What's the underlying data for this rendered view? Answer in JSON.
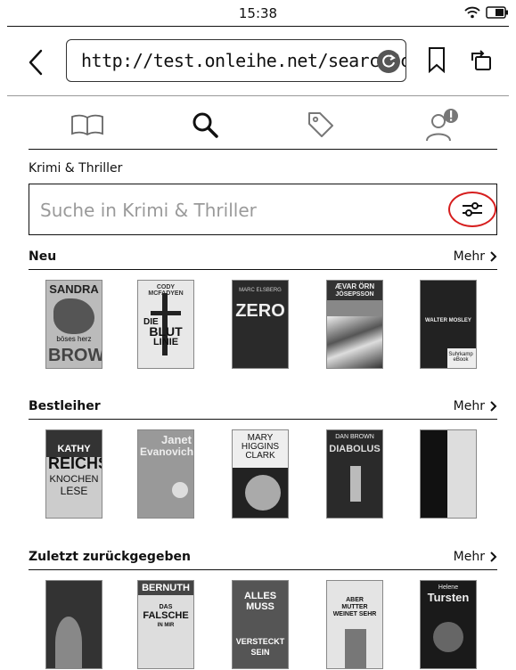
{
  "status": {
    "time": "15:38"
  },
  "browser": {
    "url": "http://test.onleihe.net/search?ci"
  },
  "breadcrumb": "Krimi & Thriller",
  "search": {
    "placeholder": "Suche in Krimi & Thriller"
  },
  "sections": [
    {
      "title": "Neu",
      "more": "Mehr",
      "books": [
        {
          "lines": [
            "SANDRA",
            "böses herz",
            "BROWN"
          ]
        },
        {
          "lines": [
            "CODY MCFADYEN",
            "DIE",
            "BLUT",
            "LINIE"
          ]
        },
        {
          "lines": [
            "MARC ELSBERG",
            "ZERO"
          ]
        },
        {
          "lines": [
            "ÆVAR ÖRN",
            "JÓSEPSSON"
          ]
        },
        {
          "lines": [
            "WALTER MOSLEY",
            "Suhrkamp eBook"
          ]
        }
      ]
    },
    {
      "title": "Bestleiher",
      "more": "Mehr",
      "books": [
        {
          "lines": [
            "KATHY",
            "REICHS",
            "KNOCHEN",
            "LESE"
          ]
        },
        {
          "lines": [
            "Janet",
            "Evanovich"
          ]
        },
        {
          "lines": [
            "MARY",
            "HIGGINS",
            "CLARK"
          ]
        },
        {
          "lines": [
            "DAN BROWN",
            "DIABOLUS"
          ]
        },
        {
          "lines": []
        }
      ]
    },
    {
      "title": "Zuletzt zurückgegeben",
      "more": "Mehr",
      "books": [
        {
          "lines": []
        },
        {
          "lines": [
            "BERNUTH",
            "DAS",
            "FALSCHE",
            "IN MIR"
          ]
        },
        {
          "lines": [
            "ALLES",
            "MUSS",
            "VERSTECKT",
            "SEIN"
          ]
        },
        {
          "lines": [
            "ABER",
            "MUTTER",
            "WEINET SEHR"
          ]
        },
        {
          "lines": [
            "Helene",
            "Tursten"
          ]
        }
      ]
    }
  ]
}
